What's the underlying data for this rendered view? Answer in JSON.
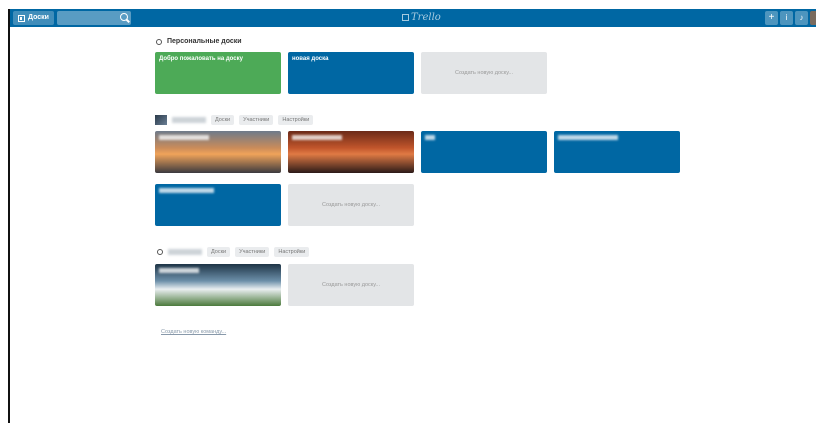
{
  "header": {
    "boards_button": "Доски",
    "logo": "Trello",
    "add_button": "+",
    "info_button": "i",
    "bell_button": "♪"
  },
  "personal": {
    "title": "Персональные доски",
    "boards": [
      {
        "label": "Добро пожаловать на доску"
      },
      {
        "label": "новая доска"
      }
    ],
    "create_label": "Создать новую доску..."
  },
  "team1": {
    "tabs": [
      "Доски",
      "Участники",
      "Настройки"
    ],
    "create_label": "Создать новую доску..."
  },
  "team2": {
    "tabs": [
      "Доски",
      "Участники",
      "Настройки"
    ],
    "create_label": "Создать новую доску..."
  },
  "create_team_link": "Создать новую команду..."
}
